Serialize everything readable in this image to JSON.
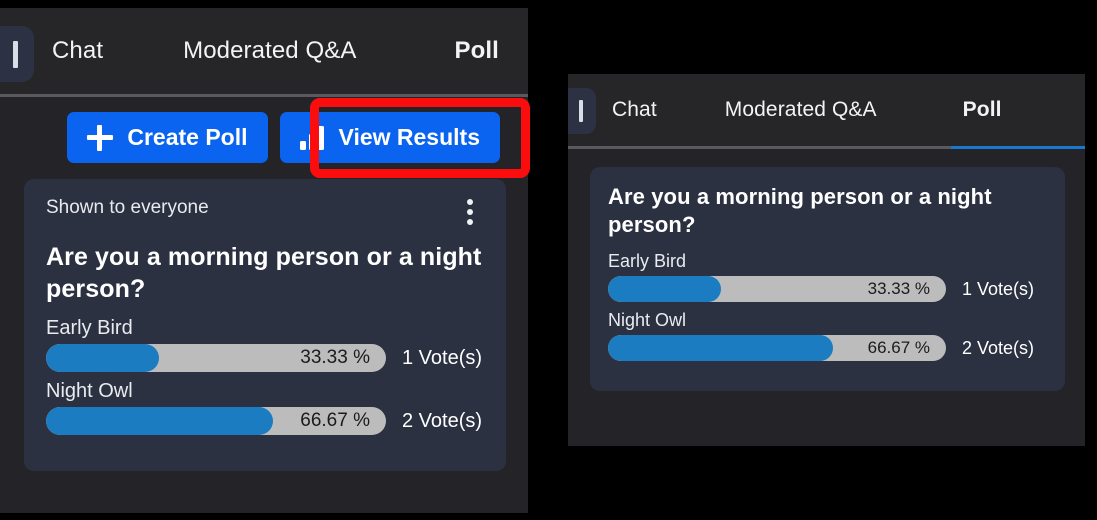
{
  "tabs": [
    {
      "label": "Chat",
      "active": false
    },
    {
      "label": "Moderated Q&A",
      "active": false
    },
    {
      "label": "Poll",
      "active": true
    }
  ],
  "sidebar_toggle": {
    "icon": "vertical-bar-icon"
  },
  "toolbar": {
    "create_poll_label": "Create Poll",
    "create_poll_icon": "plus-icon",
    "view_results_label": "View Results",
    "view_results_icon": "bar-chart-icon"
  },
  "annotation": {
    "highlight_color": "#fc0d0d",
    "target": "view-results-button"
  },
  "poll_card": {
    "visibility_label": "Shown to everyone",
    "overflow_icon": "kebab-menu-icon",
    "question": "Are you a morning person or a night person?",
    "options": [
      {
        "label": "Early Bird",
        "percent_text": "33.33 %",
        "percent_value": 33.33,
        "votes_text": "1 Vote(s)",
        "votes": 1
      },
      {
        "label": "Night Owl",
        "percent_text": "66.67 %",
        "percent_value": 66.67,
        "votes_text": "2 Vote(s)",
        "votes": 2
      }
    ]
  },
  "colors": {
    "accent_blue": "#0b64f0",
    "bar_fill": "#1c7cc2",
    "bar_track": "#bcbcbc",
    "card_bg": "#2b3141",
    "panel_bg": "#242428",
    "active_tab_indicator": "#1878d0"
  }
}
